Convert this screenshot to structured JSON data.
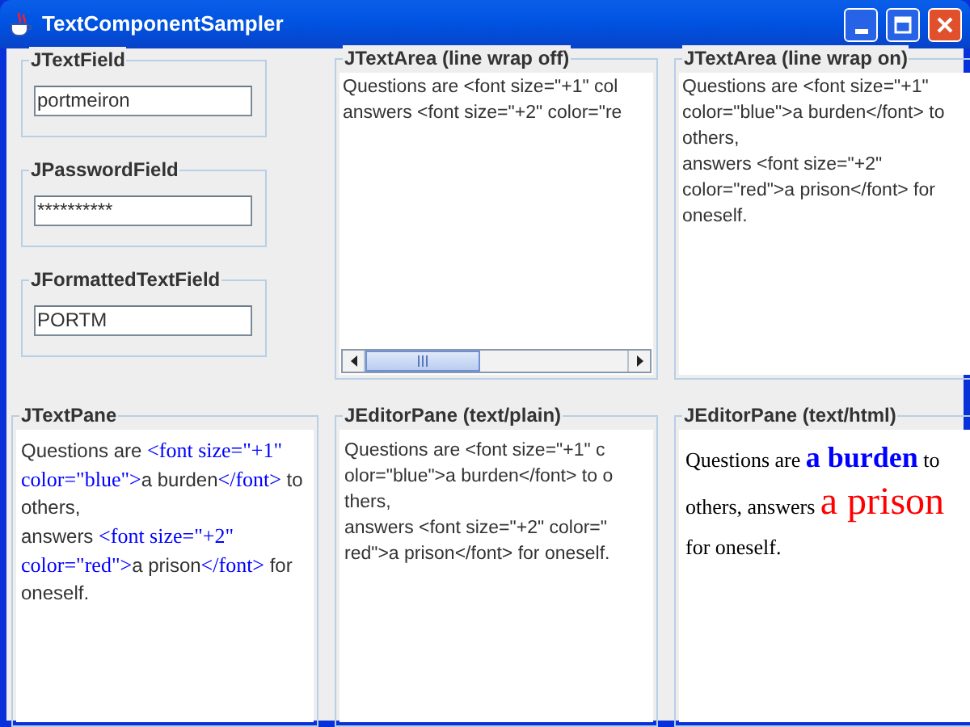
{
  "window": {
    "title": "TextComponentSampler"
  },
  "fields": [
    {
      "title": "JTextField",
      "value": "portmeiron"
    },
    {
      "title": "JPasswordField",
      "value": "**********"
    },
    {
      "title": "JFormattedTextField",
      "value": "PORTM"
    }
  ],
  "wrap_off": {
    "title": "JTextArea (line wrap off)",
    "lines": [
      "Questions are <font size=\"+1\" col",
      "answers <font size=\"+2\" color=\"re"
    ]
  },
  "wrap_on": {
    "title": "JTextArea (line wrap on)",
    "lines": [
      "Questions are <font size=\"+1\"",
      "color=\"blue\">a burden</font> to",
      "others,",
      "answers <font size=\"+2\"",
      "color=\"red\">a prison</font> for",
      "oneself."
    ]
  },
  "text_pane": {
    "title": "JTextPane",
    "lines": [
      [
        {
          "kind": "plain",
          "text": "Questions are "
        },
        {
          "kind": "tag",
          "text": "<font size=\"+1\""
        }
      ],
      [
        {
          "kind": "tag",
          "text": "color=\"blue\">"
        },
        {
          "kind": "plain",
          "text": "a burden"
        },
        {
          "kind": "tag",
          "text": "</font>"
        },
        {
          "kind": "plain",
          "text": " to"
        }
      ],
      [
        {
          "kind": "plain",
          "text": "others,"
        }
      ],
      [
        {
          "kind": "plain",
          "text": "answers "
        },
        {
          "kind": "tag",
          "text": "<font size=\"+2\""
        }
      ],
      [
        {
          "kind": "tag",
          "text": "color=\"red\">"
        },
        {
          "kind": "plain",
          "text": "a prison"
        },
        {
          "kind": "tag",
          "text": "</font>"
        },
        {
          "kind": "plain",
          "text": " for"
        }
      ],
      [
        {
          "kind": "plain",
          "text": "oneself."
        }
      ]
    ]
  },
  "editor_plain": {
    "title": "JEditorPane (text/plain)",
    "lines": [
      "Questions are <font size=\"+1\" c",
      "olor=\"blue\">a burden</font> to o",
      "thers,",
      "answers <font size=\"+2\" color=\"",
      "red\">a prison</font> for oneself."
    ]
  },
  "editor_html": {
    "title": "JEditorPane (text/html)",
    "lines": [
      [
        {
          "kind": "plain",
          "text": "Questions are "
        },
        {
          "kind": "large",
          "text": "a burden",
          "color": "#0000ff"
        },
        {
          "kind": "plain",
          "text": " to"
        }
      ],
      [
        {
          "kind": "plain",
          "text": "others, answers "
        },
        {
          "kind": "larger",
          "text": "a prison",
          "color": "#ff0000"
        }
      ],
      [
        {
          "kind": "plain",
          "text": "for oneself."
        }
      ]
    ]
  }
}
